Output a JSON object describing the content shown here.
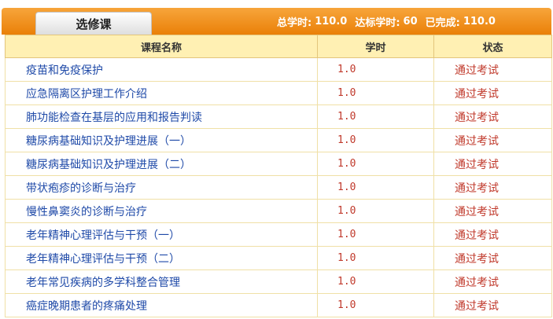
{
  "tab": {
    "label": "选修课"
  },
  "summary": {
    "total_label": "总学时:",
    "total_value": "110.0",
    "target_label": "达标学时:",
    "target_value": "60",
    "completed_label": "已完成:",
    "completed_value": "110.0"
  },
  "table": {
    "headers": {
      "name": "课程名称",
      "hours": "学时",
      "status": "状态"
    },
    "rows": [
      {
        "name": "疫苗和免疫保护",
        "hours": "1.0",
        "status": "通过考试"
      },
      {
        "name": "应急隔离区护理工作介绍",
        "hours": "1.0",
        "status": "通过考试"
      },
      {
        "name": "肺功能检查在基层的应用和报告判读",
        "hours": "1.0",
        "status": "通过考试"
      },
      {
        "name": "糖尿病基础知识及护理进展（一）",
        "hours": "1.0",
        "status": "通过考试"
      },
      {
        "name": "糖尿病基础知识及护理进展（二）",
        "hours": "1.0",
        "status": "通过考试"
      },
      {
        "name": "带状疱疹的诊断与治疗",
        "hours": "1.0",
        "status": "通过考试"
      },
      {
        "name": "慢性鼻窦炎的诊断与治疗",
        "hours": "1.0",
        "status": "通过考试"
      },
      {
        "name": "老年精神心理评估与干预（一）",
        "hours": "1.0",
        "status": "通过考试"
      },
      {
        "name": "老年精神心理评估与干预（二）",
        "hours": "1.0",
        "status": "通过考试"
      },
      {
        "name": "老年常见疾病的多学科整合管理",
        "hours": "1.0",
        "status": "通过考试"
      },
      {
        "name": "癌症晚期患者的疼痛处理",
        "hours": "1.0",
        "status": "通过考试"
      }
    ]
  },
  "colors": {
    "header_orange": "#ea8008",
    "table_header_bg": "#fff0b3",
    "link_blue": "#1f4aa8",
    "value_red": "#c0392b"
  }
}
